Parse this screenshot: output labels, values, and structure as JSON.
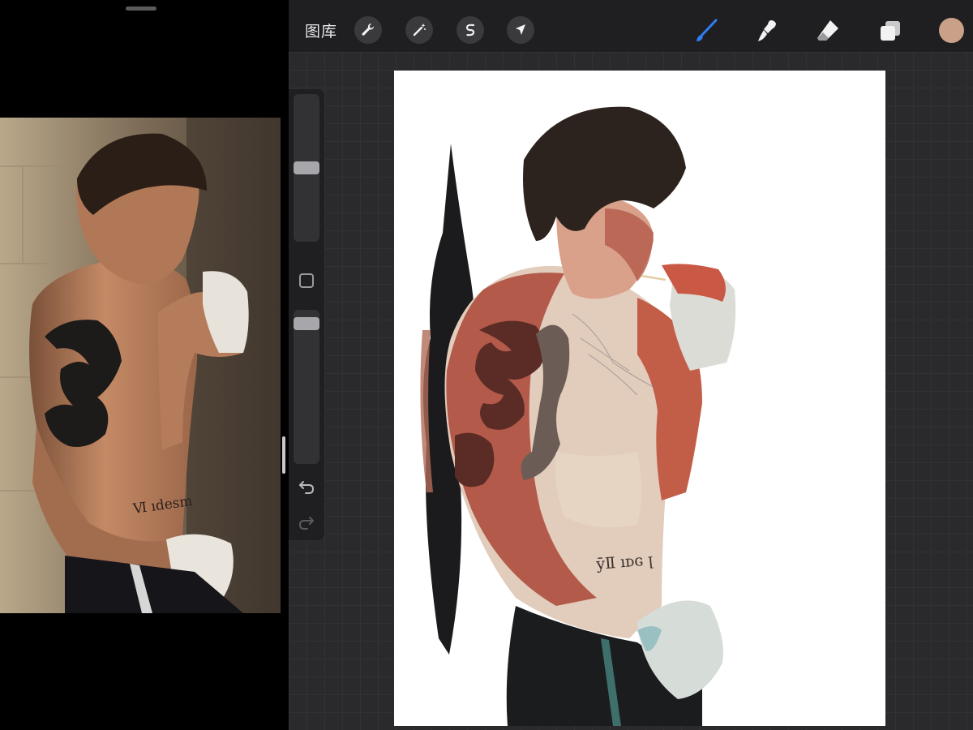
{
  "reference": {
    "photo_description_icon": "reference-photo"
  },
  "toolbar": {
    "gallery_label": "图库",
    "actions_icon": "wrench-icon",
    "adjustments_icon": "magic-wand-icon",
    "selection_icon": "selection-s-icon",
    "transform_icon": "arrow-cursor-icon",
    "brush_icon": "brush-icon",
    "smudge_icon": "smudge-icon",
    "eraser_icon": "eraser-icon",
    "layers_icon": "layers-icon",
    "current_color": "#c9a088",
    "active_tool_color": "#2f7df6"
  },
  "sidebar": {
    "brush_size_level": 0.5,
    "opacity_level": 0.05,
    "modify_icon": "square-icon",
    "undo_icon": "undo-icon",
    "redo_icon": "redo-icon"
  },
  "colors": {
    "app_bg": "#2a2a2c",
    "bar_bg": "#1f1f21",
    "canvas_bg": "#ffffff"
  }
}
